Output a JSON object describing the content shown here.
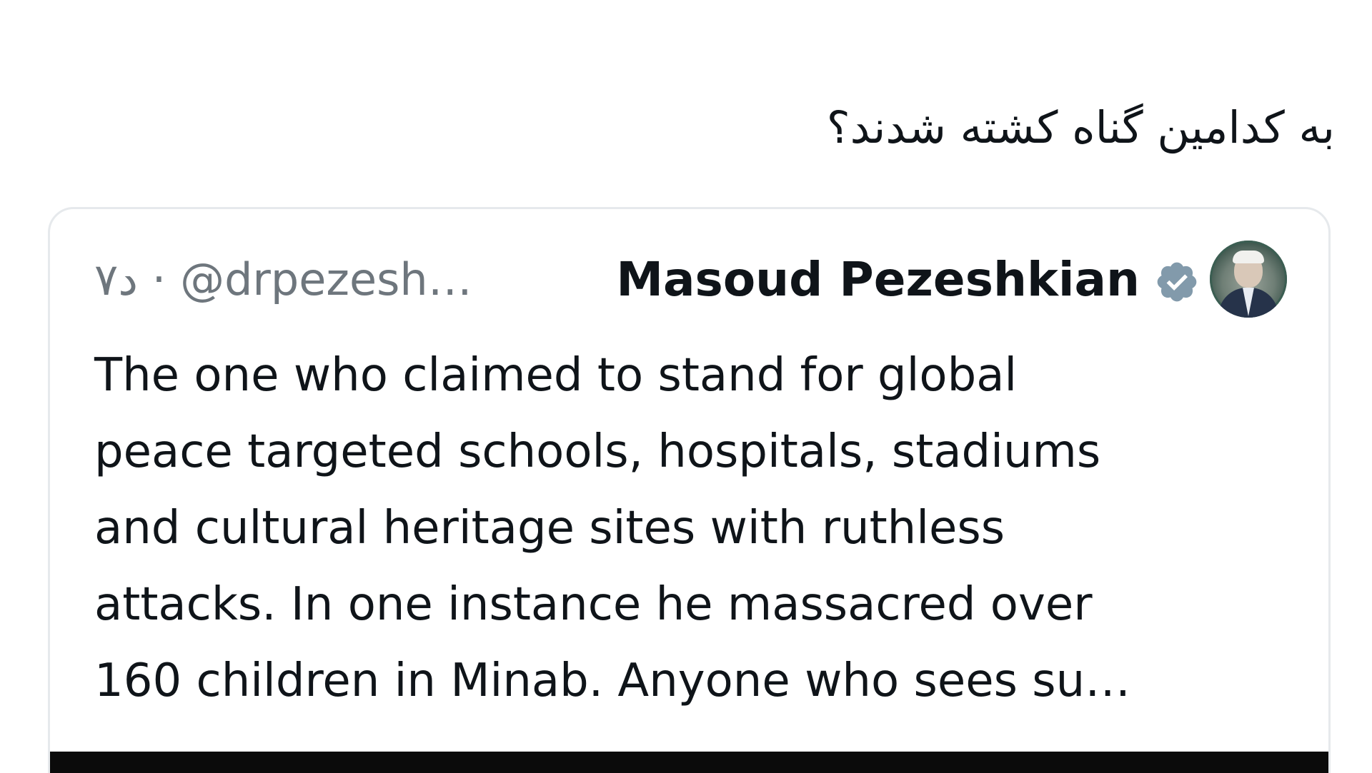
{
  "post": {
    "text": "به کدامین گناه کشته شدند؟"
  },
  "quoted_tweet": {
    "author_name": "Masoud Pezeshkian",
    "handle": "@drpezesh…",
    "separator": "·",
    "timestamp": "۷د",
    "body_lines": [
      "The one who claimed to stand for global",
      "peace targeted schools, hospitals, stadiums",
      "and cultural heritage sites with ruthless",
      "attacks. In one instance he massacred over",
      "160 children in Minab. Anyone who sees su…"
    ],
    "verified_icon": "verified-badge-icon",
    "verified_color": "#829aab"
  },
  "colors": {
    "text_primary": "#0f1419",
    "text_secondary": "#6e767d",
    "card_border": "#e6e9ec",
    "media_bg": "#0b0b0b"
  }
}
